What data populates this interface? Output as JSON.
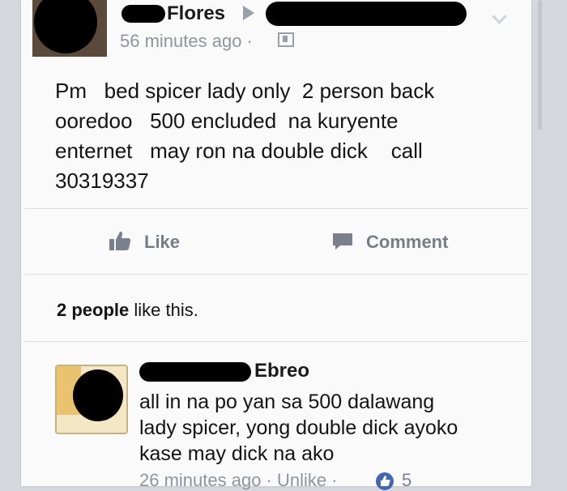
{
  "post": {
    "author_name": "Flores",
    "timestamp": "56 minutes ago ·",
    "lines": [
      "Pm   bed spicer lady only  2 person back",
      "ooredoo   500 encluded  na kuryente",
      "enternet   may ron na double dick    call",
      "30319337"
    ]
  },
  "actions": {
    "like_label": "Like",
    "comment_label": "Comment"
  },
  "likes": {
    "count_text": "2 people",
    "suffix_text": " like this."
  },
  "comment": {
    "author_name": "Ebreo",
    "lines": [
      "all in na po yan sa 500 dalawang",
      "lady spicer, yong double dick ayoko",
      "kase may dick na ako"
    ],
    "meta": "26 minutes ago · Unlike ·",
    "reaction_count": "5"
  },
  "colors": {
    "accent_link": "#4267b2",
    "muted_text": "#90949c",
    "card_bg": "#fafafa"
  },
  "icons": [
    "like-icon",
    "comment-icon",
    "privacy-icon",
    "chevron-down-icon",
    "share-arrow-icon"
  ]
}
